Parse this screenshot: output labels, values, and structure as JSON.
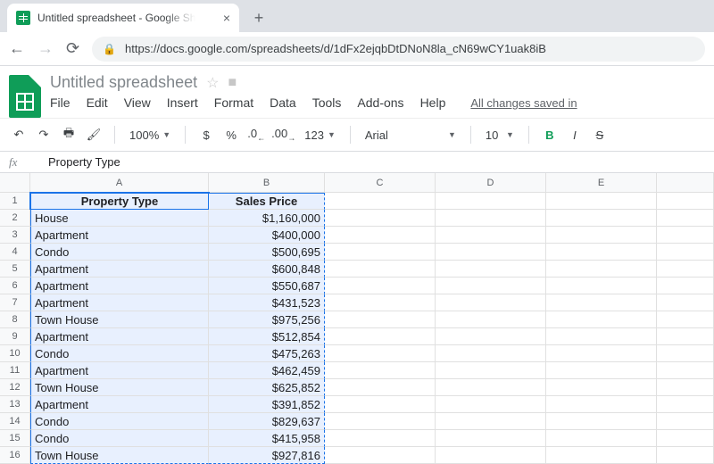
{
  "browser": {
    "tab_title": "Untitled spreadsheet - Google Sh",
    "url": "https://docs.google.com/spreadsheets/d/1dFx2ejqbDtDNoN8la_cN69wCY1uak8iB"
  },
  "docs": {
    "title": "Untitled spreadsheet",
    "menus": [
      "File",
      "Edit",
      "View",
      "Insert",
      "Format",
      "Data",
      "Tools",
      "Add-ons",
      "Help"
    ],
    "saved_label": "All changes saved in"
  },
  "toolbar": {
    "zoom": "100%",
    "currency": "$",
    "percent": "%",
    "dec_dec": ".0",
    "inc_dec": ".00",
    "num_format": "123",
    "font": "Arial",
    "size": "10",
    "strike": "S"
  },
  "formula_bar": {
    "fx_label": "fx",
    "value": "Property Type"
  },
  "sheet": {
    "col_labels": [
      "A",
      "B",
      "C",
      "D",
      "E"
    ],
    "row_labels": [
      "1",
      "2",
      "3",
      "4",
      "5",
      "6",
      "7",
      "8",
      "9",
      "10",
      "11",
      "12",
      "13",
      "14",
      "15",
      "16"
    ],
    "headers": {
      "col_a": "Property Type",
      "col_b": "Sales Price"
    },
    "rows": [
      {
        "type": "House",
        "price": "$1,160,000"
      },
      {
        "type": "Apartment",
        "price": "$400,000"
      },
      {
        "type": "Condo",
        "price": "$500,695"
      },
      {
        "type": "Apartment",
        "price": "$600,848"
      },
      {
        "type": "Apartment",
        "price": "$550,687"
      },
      {
        "type": "Apartment",
        "price": "$431,523"
      },
      {
        "type": "Town House",
        "price": "$975,256"
      },
      {
        "type": "Apartment",
        "price": "$512,854"
      },
      {
        "type": "Condo",
        "price": "$475,263"
      },
      {
        "type": "Apartment",
        "price": "$462,459"
      },
      {
        "type": "Town House",
        "price": "$625,852"
      },
      {
        "type": "Apartment",
        "price": "$391,852"
      },
      {
        "type": "Condo",
        "price": "$829,637"
      },
      {
        "type": "Condo",
        "price": "$415,958"
      },
      {
        "type": "Town House",
        "price": "$927,816"
      }
    ]
  }
}
